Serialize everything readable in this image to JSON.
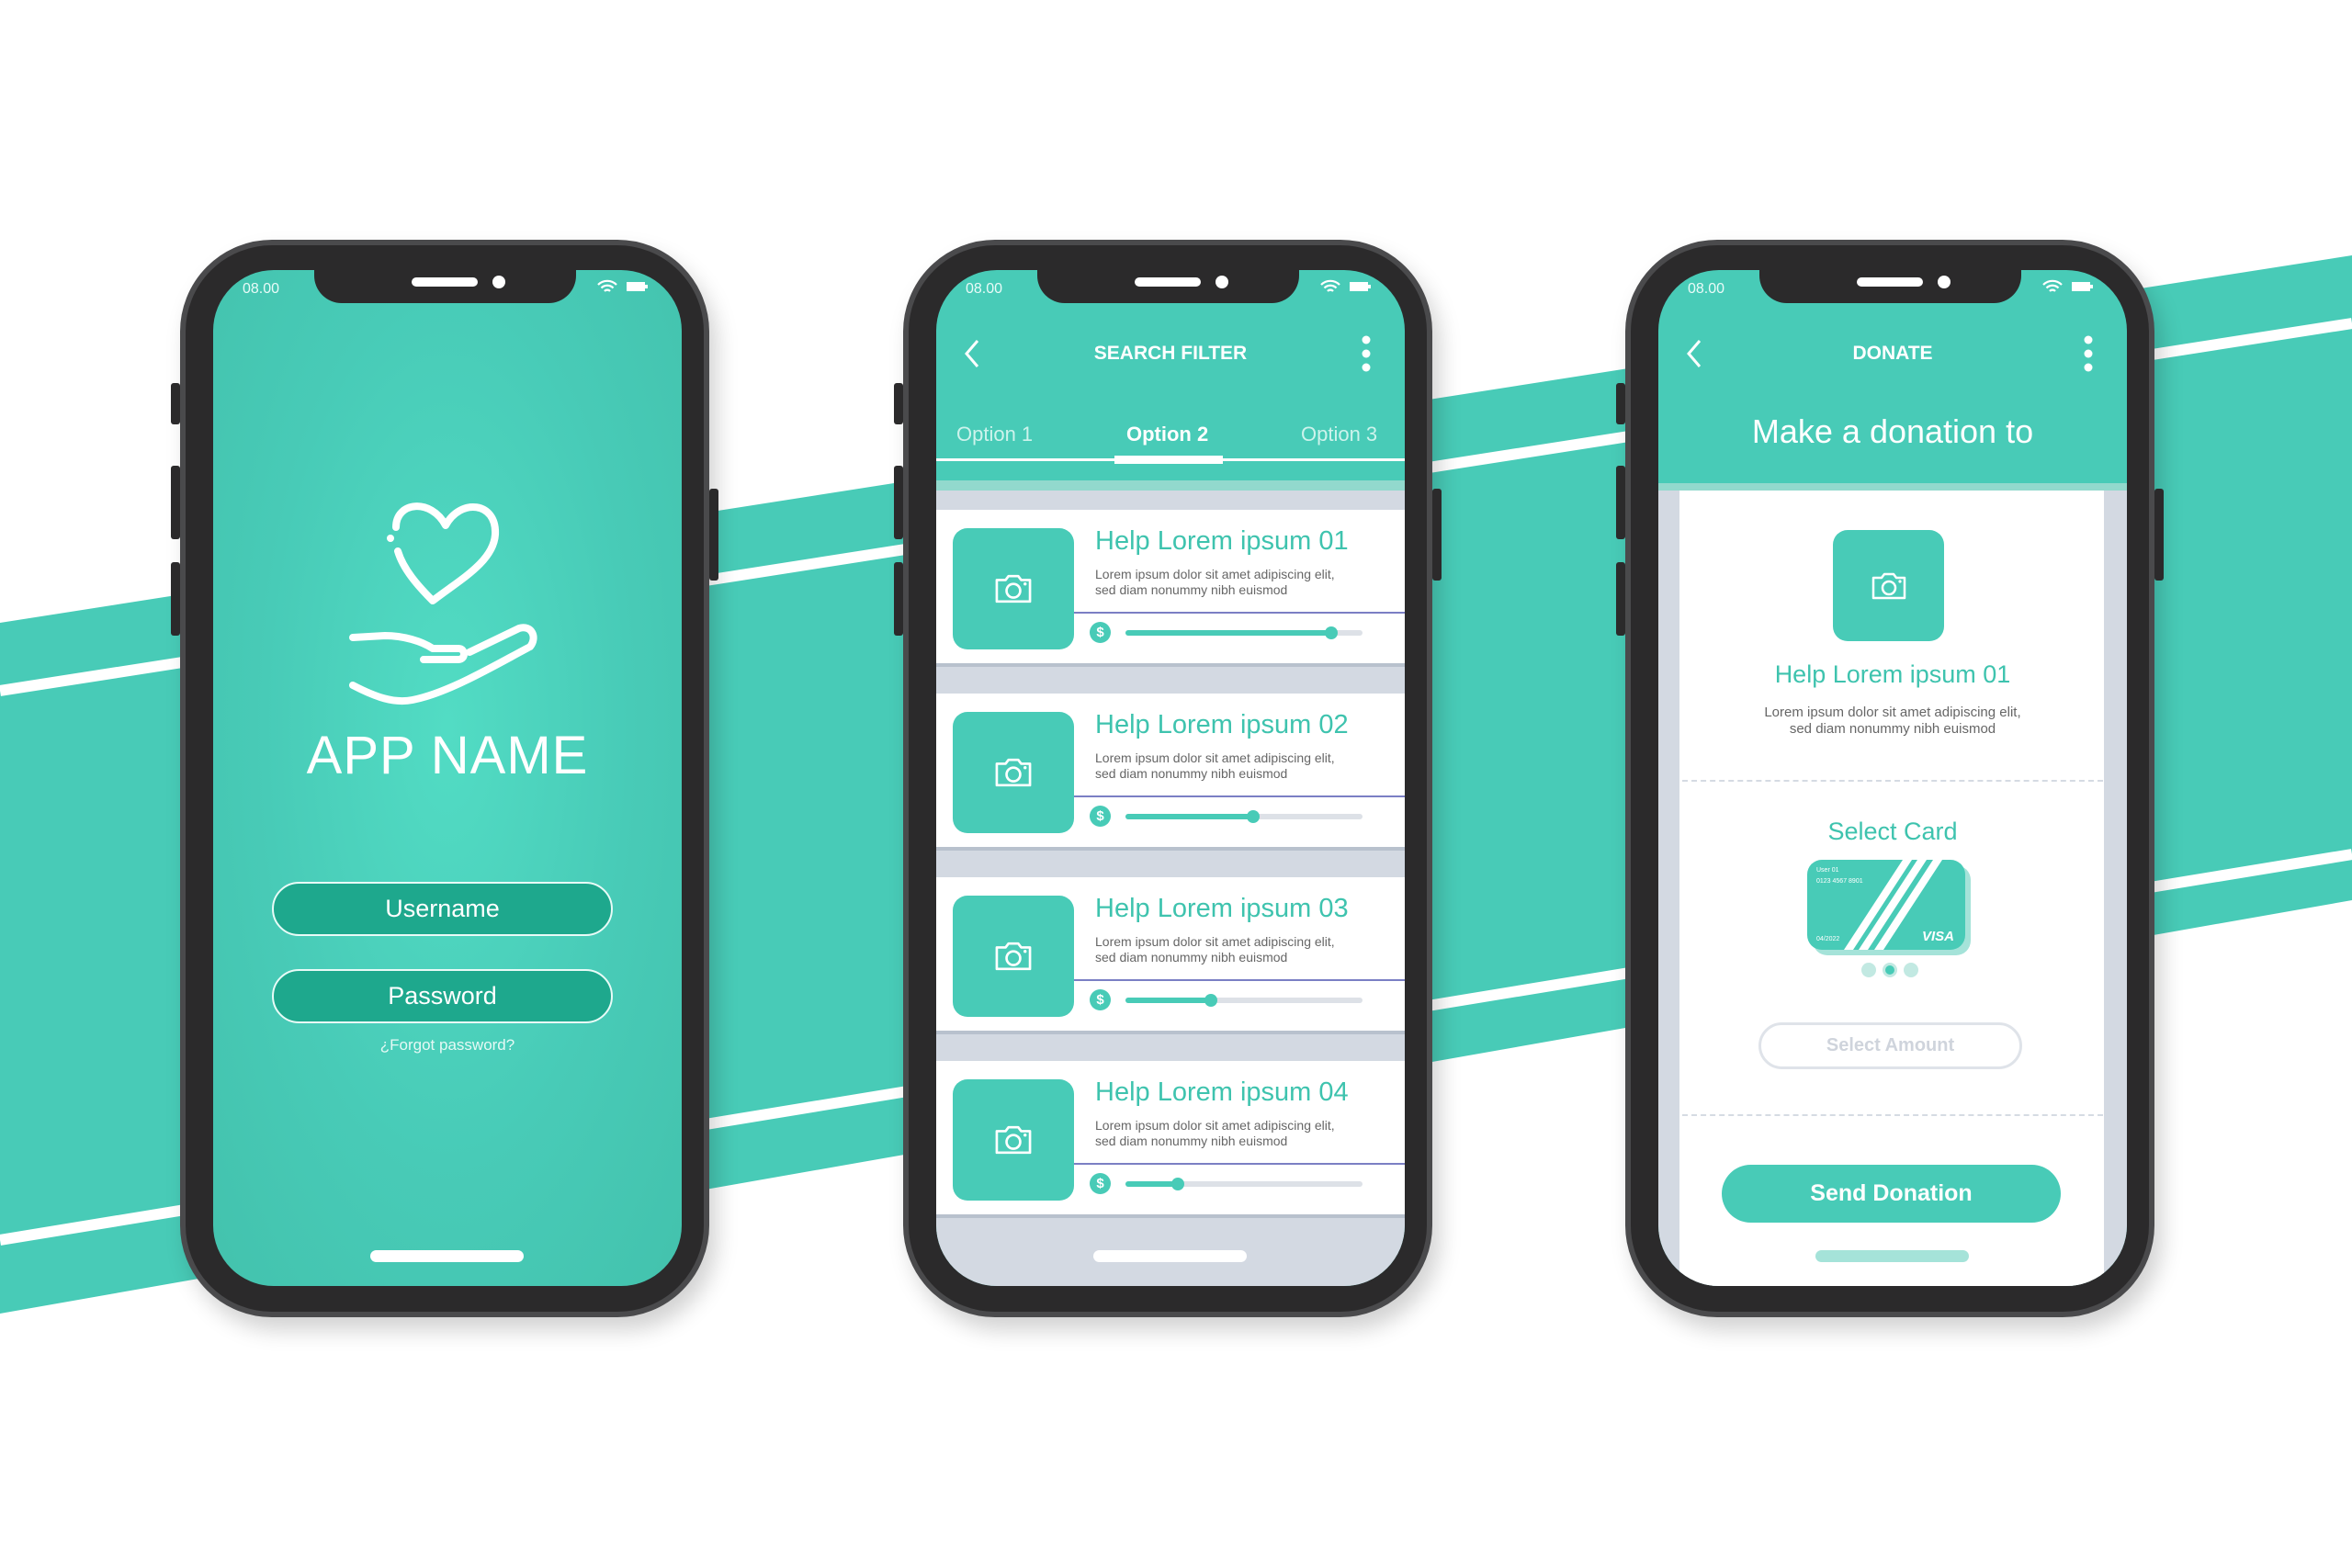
{
  "colors": {
    "teal": "#48cbb7",
    "dark_teal": "#1ea88d",
    "gray": "#d3d9e2"
  },
  "status": {
    "time": "08.00"
  },
  "login": {
    "app_name": "APP NAME",
    "username_placeholder": "Username",
    "password_placeholder": "Password",
    "forgot": "¿Forgot password?",
    "logo_icon": "heart-hand-icon"
  },
  "search": {
    "title": "SEARCH FILTER",
    "tabs": [
      {
        "label": "Option 1"
      },
      {
        "label": "Option 2",
        "active": true
      },
      {
        "label": "Option 3"
      }
    ],
    "cards": [
      {
        "title": "Help Lorem ipsum 01",
        "desc1": "Lorem ipsum dolor sit amet  adipiscing elit,",
        "desc2": "sed diam nonummy nibh euismod",
        "progress": 0.87
      },
      {
        "title": "Help Lorem ipsum 02",
        "desc1": "Lorem ipsum dolor sit amet  adipiscing elit,",
        "desc2": "sed diam nonummy nibh euismod",
        "progress": 0.54
      },
      {
        "title": "Help Lorem ipsum 03",
        "desc1": "Lorem ipsum dolor sit amet  adipiscing elit,",
        "desc2": "sed diam nonummy nibh euismod",
        "progress": 0.36
      },
      {
        "title": "Help Lorem ipsum 04",
        "desc1": "Lorem ipsum dolor sit amet  adipiscing elit,",
        "desc2": "sed diam nonummy nibh euismod",
        "progress": 0.22
      }
    ],
    "currency_symbol": "$"
  },
  "donate": {
    "title": "DONATE",
    "heading": "Make a donation to",
    "item_title": "Help Lorem ipsum 01",
    "desc1": "Lorem ipsum dolor sit amet  adipiscing elit,",
    "desc2": "sed diam nonummy nibh euismod",
    "select_card": "Select Card",
    "card": {
      "user": "User 01",
      "number": "0123 4567 8901",
      "expiry": "04/2022",
      "brand": "VISA"
    },
    "card_page": 2,
    "card_pages": 3,
    "amount_placeholder": "Select Amount",
    "send": "Send Donation"
  }
}
